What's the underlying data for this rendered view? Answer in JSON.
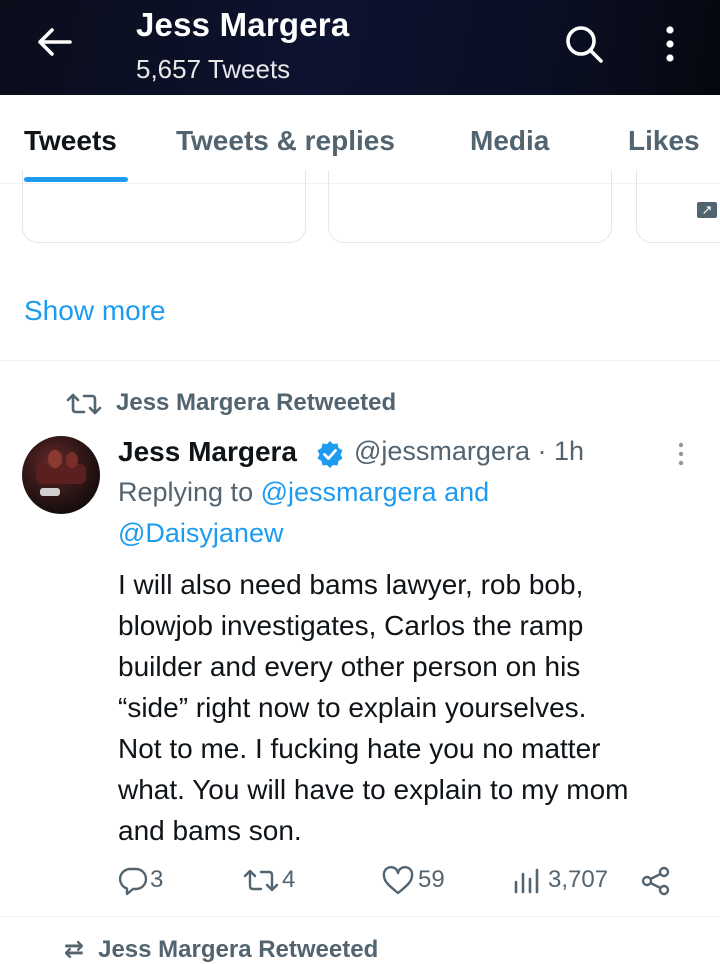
{
  "header": {
    "title": "Jess Margera",
    "subtitle": "5,657 Tweets",
    "icons": [
      "back-arrow-icon",
      "search-icon",
      "more-vertical-icon"
    ]
  },
  "tabs": [
    {
      "label": "Tweets",
      "active": true
    },
    {
      "label": "Tweets & replies",
      "active": false
    },
    {
      "label": "Media",
      "active": false
    },
    {
      "label": "Likes",
      "active": false
    }
  ],
  "show_more": "Show more",
  "tweet": {
    "retweet_label": "Jess Margera Retweeted",
    "author_name": "Jess Margera",
    "handle_time": "@jessmargera · 1h",
    "replying_prefix": "Replying to ",
    "replying_user1": "@jessmargera",
    "replying_and": " and",
    "replying_user2": "@Daisyjanew",
    "body_lines": [
      "I will also need bams lawyer, rob bob,",
      "blowjob investigates, Carlos the ramp",
      "builder and every other person on his",
      "“side” right now to explain yourselves.",
      "Not to me. I fucking hate you no matter",
      "what. You will have to explain to my mom",
      "and bams son."
    ],
    "stats": {
      "replies": "3",
      "retweets": "4",
      "likes": "59",
      "views": "3,707"
    }
  },
  "next_retweet_label": "Jess Margera Retweeted",
  "colors": {
    "accent": "#1d9bf0",
    "muted": "#536471",
    "text": "#0f1419",
    "header_bg": "#0b1028"
  }
}
